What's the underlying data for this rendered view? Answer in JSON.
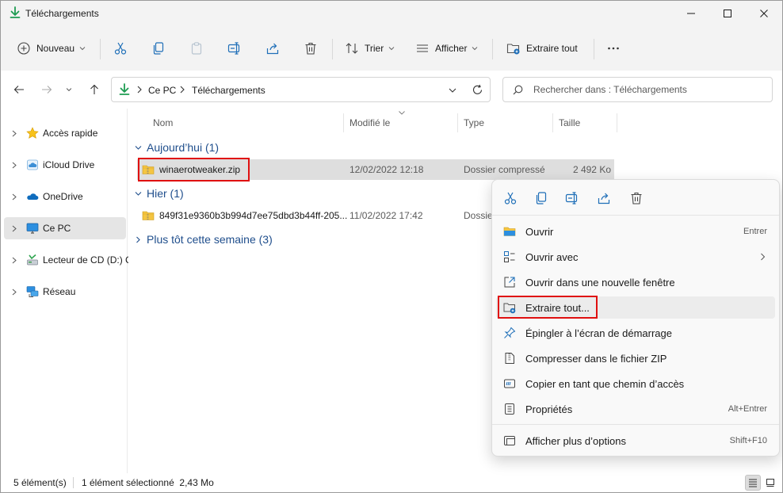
{
  "window": {
    "title": "Téléchargements"
  },
  "toolbar": {
    "new_label": "Nouveau",
    "sort_label": "Trier",
    "view_label": "Afficher",
    "extract_label": "Extraire tout"
  },
  "address": {
    "crumbs": [
      "Ce PC",
      "Téléchargements"
    ]
  },
  "search": {
    "placeholder": "Rechercher dans : Téléchargements"
  },
  "sidebar": {
    "items": [
      {
        "label": "Accès rapide",
        "icon": "star-icon"
      },
      {
        "label": "iCloud Drive",
        "icon": "icloud-icon"
      },
      {
        "label": "OneDrive",
        "icon": "cloud-icon"
      },
      {
        "label": "Ce PC",
        "icon": "monitor-icon"
      },
      {
        "label": "Lecteur de CD (D:) C",
        "icon": "cd-drive-icon"
      },
      {
        "label": "Réseau",
        "icon": "network-icon"
      }
    ]
  },
  "columns": {
    "name": "Nom",
    "modified": "Modifié le",
    "type": "Type",
    "size": "Taille"
  },
  "groups": {
    "today": "Aujourd’hui (1)",
    "yesterday": "Hier (1)",
    "earlier": "Plus tôt cette semaine (3)"
  },
  "files": [
    {
      "name": "winaerotweaker.zip",
      "modified": "12/02/2022 12:18",
      "type": "Dossier compressé",
      "size": "2 492 Ko"
    },
    {
      "name": "849f31e9360b3b994d7ee75dbd3b44ff-205...",
      "modified": "11/02/2022 17:42",
      "type": "Dossie",
      "size": ""
    }
  ],
  "context_menu": {
    "items": [
      {
        "label": "Ouvrir",
        "shortcut": "Entrer"
      },
      {
        "label": "Ouvrir avec",
        "shortcut": ""
      },
      {
        "label": "Ouvrir dans une nouvelle fenêtre",
        "shortcut": ""
      },
      {
        "label": "Extraire tout...",
        "shortcut": ""
      },
      {
        "label": "Épingler à l’écran de démarrage",
        "shortcut": ""
      },
      {
        "label": "Compresser dans le fichier ZIP",
        "shortcut": ""
      },
      {
        "label": "Copier en tant que chemin d’accès",
        "shortcut": ""
      },
      {
        "label": "Propriétés",
        "shortcut": "Alt+Entrer"
      },
      {
        "label": "Afficher plus d’options",
        "shortcut": "Shift+F10"
      }
    ]
  },
  "status": {
    "count": "5 élément(s)",
    "selection": "1 élément sélectionné  2,43 Mo"
  },
  "colors": {
    "accent": "#1f4e8c",
    "highlight": "#e01010",
    "download_green": "#1e9c52"
  }
}
